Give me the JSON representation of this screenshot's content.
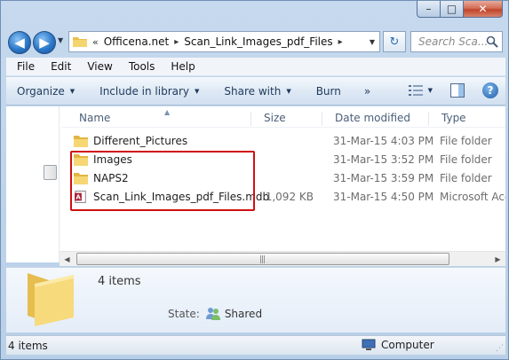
{
  "window": {
    "caption_min": "–",
    "caption_max": "□",
    "caption_close": "✕"
  },
  "nav": {
    "back_icon": "◀",
    "forward_icon": "▶",
    "history_dropdown": "▼"
  },
  "address": {
    "overflow": "«",
    "segments": [
      "Officena.net",
      "Scan_Link_Images_pdf_Files"
    ],
    "separator": "▸",
    "dropdown": "▼"
  },
  "refresh_icon": "↻",
  "search": {
    "placeholder": "Search Sca..."
  },
  "menu": {
    "items": [
      "File",
      "Edit",
      "View",
      "Tools",
      "Help"
    ]
  },
  "commands": {
    "organize": "Organize",
    "include_in_library": "Include in library",
    "share_with": "Share with",
    "burn": "Burn",
    "more": "»",
    "dropdown": "▼",
    "help": "?"
  },
  "columns": {
    "name": "Name",
    "size": "Size",
    "date_modified": "Date modified",
    "type": "Type",
    "sort_indicator": "▲"
  },
  "files": [
    {
      "name": "Different_Pictures",
      "size": "",
      "date": "31-Mar-15 4:03 PM",
      "type": "File folder",
      "icon": "folder-icon"
    },
    {
      "name": "Images",
      "size": "",
      "date": "31-Mar-15 3:52 PM",
      "type": "File folder",
      "icon": "folder-icon"
    },
    {
      "name": "NAPS2",
      "size": "",
      "date": "31-Mar-15 3:59 PM",
      "type": "File folder",
      "icon": "folder-icon"
    },
    {
      "name": "Scan_Link_Images_pdf_Files.mdb",
      "size": "1,092 KB",
      "date": "31-Mar-15 4:50 PM",
      "type": "Microsoft Acc",
      "icon": "access-database-icon"
    }
  ],
  "scrollbar": {
    "left": "◀",
    "right": "▶",
    "grip": "|||"
  },
  "details": {
    "count": "4 items",
    "state_label": "State:",
    "state_value": "Shared"
  },
  "status": {
    "items": "4 items",
    "location": "Computer"
  },
  "colors": {
    "highlight": "#d01010",
    "folder": "#f2cf63",
    "accent": "#2a77c8"
  }
}
